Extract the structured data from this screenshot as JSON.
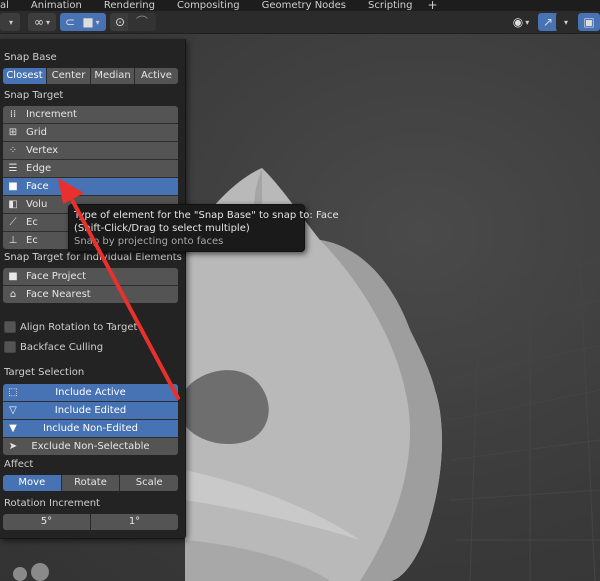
{
  "menu": {
    "items": [
      "al",
      "Animation",
      "Rendering",
      "Compositing",
      "Geometry Nodes",
      "Scripting"
    ],
    "plus": "+"
  },
  "panel": {
    "snap_base": {
      "label": "Snap Base",
      "options": [
        "Closest",
        "Center",
        "Median",
        "Active"
      ],
      "selected": "Closest"
    },
    "snap_target": {
      "label": "Snap Target",
      "items": [
        "Increment",
        "Grid",
        "Vertex",
        "Edge",
        "Face",
        "Volume",
        "Edge Center",
        "Edge Perpendicular"
      ],
      "visible_items": [
        "Increment",
        "Grid",
        "Vertex",
        "Edge",
        "Face",
        "Volu",
        "Ec",
        "Ec"
      ],
      "selected": "Face"
    },
    "individual": {
      "label": "Snap Target for Individual Elements",
      "items": [
        "Face Project",
        "Face Nearest"
      ]
    },
    "checks": {
      "align_rotation": "Align Rotation to Target",
      "backface_culling": "Backface Culling"
    },
    "target_selection": {
      "label": "Target Selection",
      "items": [
        "Include Active",
        "Include Edited",
        "Include Non-Edited",
        "Exclude Non-Selectable"
      ]
    },
    "affect": {
      "label": "Affect",
      "options": [
        "Move",
        "Rotate",
        "Scale"
      ],
      "selected": "Move"
    },
    "rotation_increment": {
      "label": "Rotation Increment",
      "values": [
        "5°",
        "1°"
      ]
    }
  },
  "tooltip": {
    "line1_prefix": "Type of element for the \"Snap Base\" to snap to:",
    "line1_value": "Face",
    "line2": "(Shift-Click/Drag to select multiple)",
    "line3": "Snap by projecting onto faces"
  },
  "colors": {
    "accent": "#4772b3",
    "arrow": "#e8302c",
    "panel_bg": "#232323",
    "button_bg": "#545454"
  }
}
